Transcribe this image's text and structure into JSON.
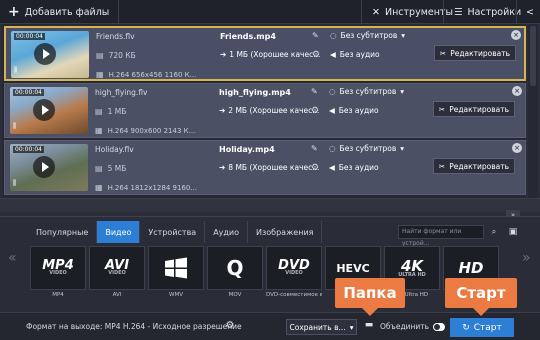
{
  "toolbar": {
    "add_files": "Добавить файлы",
    "tools": "Инструменты",
    "settings": "Настройки"
  },
  "files": [
    {
      "time": "00:00:04",
      "source_name": "Friends.flv",
      "source_size": "720 КБ",
      "source_info": "H.264 656x456 1160 К...",
      "output_name": "Friends.mp4",
      "output_size": "1 МБ (Хорошее качес...",
      "subtitles": "Без субтитров",
      "audio": "Без аудио",
      "edit": "Редактировать",
      "selected": true
    },
    {
      "time": "00:00:04",
      "source_name": "high_flying.flv",
      "source_size": "1 МБ",
      "source_info": "H.264 900x600 2143 К...",
      "output_name": "high_flying.mp4",
      "output_size": "2 МБ (Хорошее качес...",
      "subtitles": "Без субтитров",
      "audio": "Без аудио",
      "edit": "Редактировать",
      "selected": false
    },
    {
      "time": "00:00:04",
      "source_name": "Holiday.flv",
      "source_size": "5 МБ",
      "source_info": "H.264 1812x1284 9160...",
      "output_name": "Holiday.mp4",
      "output_size": "8 МБ (Хорошее качес...",
      "subtitles": "Без субтитров",
      "audio": "Без аудио",
      "edit": "Редактировать",
      "selected": false
    }
  ],
  "tabs": [
    "Популярные",
    "Видео",
    "Устройства",
    "Аудио",
    "Изображения"
  ],
  "active_tab": "Видео",
  "search_placeholder": "Найти формат или устрой...",
  "formats": [
    {
      "logo": "MP4",
      "sub": "VIDEO",
      "label": "MP4"
    },
    {
      "logo": "AVI",
      "sub": "VIDEO",
      "label": "AVI"
    },
    {
      "logo": "WMV",
      "sub": "",
      "label": "WMV"
    },
    {
      "logo": "Q",
      "sub": "",
      "label": "MOV"
    },
    {
      "logo": "DVD",
      "sub": "VIDEO",
      "label": "DVD-совместимое в..."
    },
    {
      "logo": "HEVC",
      "sub": "",
      "label": ""
    },
    {
      "logo": "4K",
      "sub": "ULTRA HD",
      "label": "4K Ultra HD"
    },
    {
      "logo": "HD",
      "sub": "",
      "label": ""
    }
  ],
  "bottom": {
    "output_format": "Формат на выходе: MP4 H.264 - Исходное разрешение",
    "save_to": "Сохранить в...",
    "merge": "Объединить",
    "start": "Старт"
  },
  "callouts": {
    "folder": "Папка",
    "start": "Старт"
  },
  "colors": {
    "accent": "#2d7fd6",
    "callout": "#ec7b43",
    "selection": "#d6b451"
  }
}
